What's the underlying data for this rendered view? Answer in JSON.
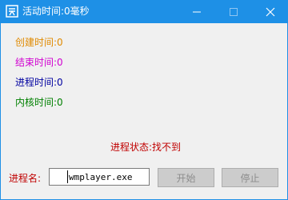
{
  "window": {
    "title": "活动时间:0毫秒",
    "app_icon": "app-logo-icon",
    "controls": {
      "minimize_icon": "minimize-icon",
      "maximize_icon": "maximize-icon",
      "close_icon": "close-icon"
    }
  },
  "times": {
    "create": {
      "text": "创建时间:0",
      "color": "#e08a00"
    },
    "end": {
      "text": "结束时间:0",
      "color": "#d000d0"
    },
    "process": {
      "text": "进程时间:0",
      "color": "#0000a0"
    },
    "kernel": {
      "text": "内核时间:0",
      "color": "#008000"
    }
  },
  "status": {
    "text": "进程状态:找不到",
    "color": "#c00000"
  },
  "process_name": {
    "label": "进程名:",
    "value": "wmplayer.exe"
  },
  "buttons": {
    "start_label": "开始",
    "stop_label": "停止"
  },
  "colors": {
    "titlebar": "#1e90e6",
    "background": "#f0f0f0",
    "disabled_button": "#cccccc"
  }
}
